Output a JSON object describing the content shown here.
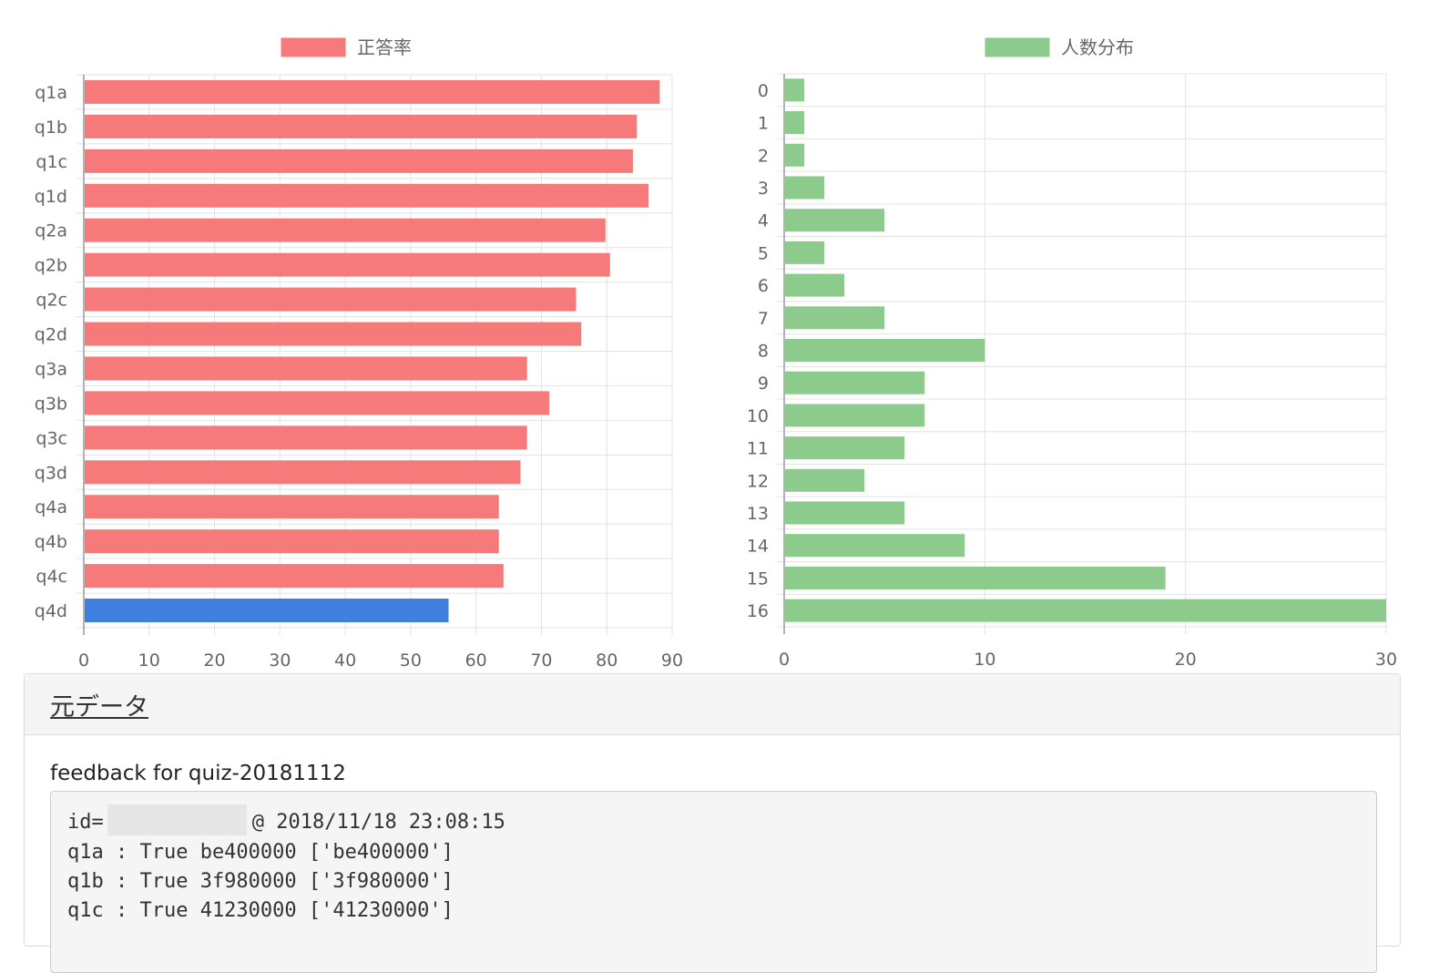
{
  "chart_data": [
    {
      "type": "bar",
      "orientation": "horizontal",
      "categories": [
        "q1a",
        "q1b",
        "q1c",
        "q1d",
        "q2a",
        "q2b",
        "q2c",
        "q2d",
        "q3a",
        "q3b",
        "q3c",
        "q3d",
        "q4a",
        "q4b",
        "q4c",
        "q4d"
      ],
      "series": [
        {
          "name": "正答率",
          "values": [
            88.1,
            84.6,
            84,
            86.4,
            79.8,
            80.5,
            75.3,
            76.1,
            67.8,
            71.2,
            67.8,
            66.8,
            63.5,
            63.5,
            64.2,
            55.8
          ]
        }
      ],
      "bar_colors": [
        "#f77a7a",
        "#f77a7a",
        "#f77a7a",
        "#f77a7a",
        "#f77a7a",
        "#f77a7a",
        "#f77a7a",
        "#f77a7a",
        "#f77a7a",
        "#f77a7a",
        "#f77a7a",
        "#f77a7a",
        "#f77a7a",
        "#f77a7a",
        "#f77a7a",
        "#3f7fdf"
      ],
      "x_ticks": [
        0,
        10,
        20,
        30,
        40,
        50,
        60,
        70,
        80,
        90
      ],
      "xlim": [
        0,
        90
      ],
      "grid": true,
      "legend_position": "top-center",
      "legend_color": "#f77a7a"
    },
    {
      "type": "bar",
      "orientation": "horizontal",
      "categories": [
        "0",
        "1",
        "2",
        "3",
        "4",
        "5",
        "6",
        "7",
        "8",
        "9",
        "10",
        "11",
        "12",
        "13",
        "14",
        "15",
        "16"
      ],
      "series": [
        {
          "name": "人数分布",
          "values": [
            1,
            1,
            1,
            2,
            5,
            2,
            3,
            5,
            10,
            7,
            7,
            6,
            4,
            6,
            9,
            19,
            30
          ]
        }
      ],
      "bar_color": "#8ccb8c",
      "x_ticks": [
        0,
        10,
        20,
        30
      ],
      "xlim": [
        0,
        30
      ],
      "grid": true,
      "legend_position": "top-center",
      "legend_color": "#8ccb8c"
    }
  ],
  "panel": {
    "title": "元データ",
    "feedback_title": "feedback for quiz-20181112",
    "id_prefix": "id=",
    "id_suffix": "@ 2018/11/18 23:08:15",
    "lines": [
      "q1a : True be400000 ['be400000']",
      "q1b : True 3f980000 ['3f980000']",
      "q1c : True 41230000 ['41230000']"
    ]
  }
}
